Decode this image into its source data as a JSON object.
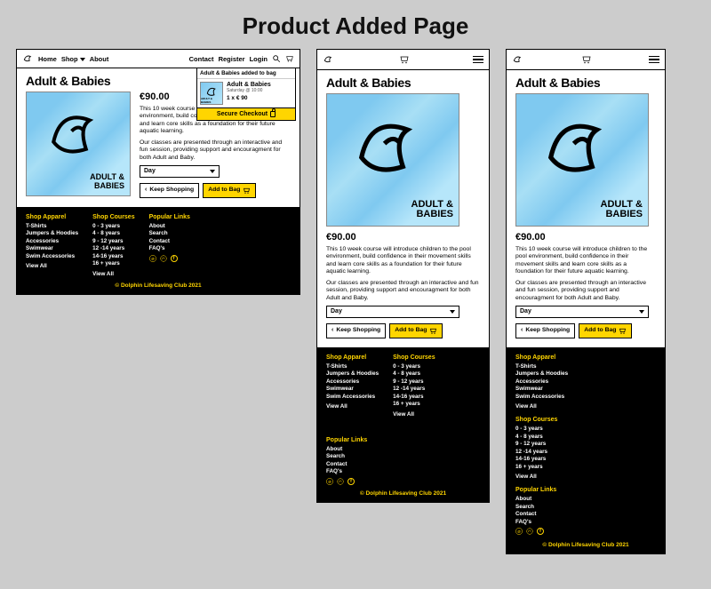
{
  "page_heading": "Product Added Page",
  "nav": {
    "home": "Home",
    "shop": "Shop",
    "about": "About",
    "contact": "Contact",
    "register": "Register",
    "login": "Login"
  },
  "product": {
    "title": "Adult & Babies",
    "price": "€90.00",
    "img_label_line1": "ADULT &",
    "img_label_line2": "BABIES",
    "desc1": "This 10 week course will introduce children to the pool environment, build confidence in their movement skills and learn core skills as a foundation for their future aquatic learning.",
    "desc2": "Our classes are presented through an interactive and fun session, providing support and encouragment for both Adult and Baby.",
    "day_label": "Day",
    "keep_shopping": "Keep Shopping",
    "add_to_bag": "Add to Bag"
  },
  "toast": {
    "header": "Adult & Babies added to bag",
    "name": "Adult & Babies",
    "sub": "Saturday @ 10:00",
    "qty": "1 x € 90",
    "checkout": "Secure Checkout",
    "thumb_label": "ADULT & BABIES"
  },
  "footer": {
    "apparel_h": "Shop Apparel",
    "apparel": [
      "T-Shirts",
      "Jumpers & Hoodies",
      "Accessories",
      "Swimwear",
      "Swim Accessories"
    ],
    "courses_h": "Shop Courses",
    "courses": [
      "0 - 3 years",
      "4 - 8 years",
      "9 - 12 years",
      "12 -14 years",
      "14-16 years",
      "16 + years"
    ],
    "links_h": "Popular Links",
    "links": [
      "About",
      "Search",
      "Contact",
      "FAQ's"
    ],
    "view_all": "View All",
    "copy": "© Dolphin Lifesaving Club 2021"
  }
}
